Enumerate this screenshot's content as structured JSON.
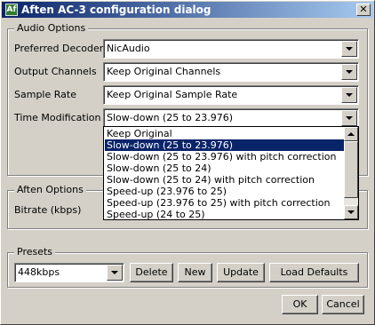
{
  "window": {
    "title": "Aften AC-3 configuration dialog",
    "icon_text": "Af",
    "close_glyph": "✕"
  },
  "audio_options": {
    "legend": "Audio Options",
    "preferred_decoder": {
      "label": "Preferred Decoder",
      "value": "NicAudio"
    },
    "output_channels": {
      "label": "Output Channels",
      "value": "Keep Original Channels"
    },
    "sample_rate": {
      "label": "Sample Rate",
      "value": "Keep Original Sample Rate"
    },
    "time_modification": {
      "label": "Time Modification",
      "value": "Slow-down (25 to 23.976)",
      "options": [
        "Keep Original",
        "Slow-down (25 to 23.976)",
        "Slow-down (25 to 23.976) with pitch correction",
        "Slow-down (25 to 24)",
        "Slow-down (25 to 24) with pitch correction",
        "Speed-up (23.976 to 25)",
        "Speed-up (23.976 to 25) with pitch correction",
        "Speed-up (24 to 25)"
      ],
      "selected_index": 1
    }
  },
  "aften_options": {
    "legend": "Aften Options",
    "bitrate_label": "Bitrate (kbps)"
  },
  "presets": {
    "legend": "Presets",
    "value": "448kbps",
    "delete": "Delete",
    "new": "New",
    "update": "Update",
    "load_defaults": "Load Defaults"
  },
  "footer": {
    "ok": "OK",
    "cancel": "Cancel"
  },
  "colors": {
    "titlebar_start": "#0a246a",
    "titlebar_end": "#a6caf0",
    "selection": "#0a246a",
    "face": "#d4d0c8"
  }
}
